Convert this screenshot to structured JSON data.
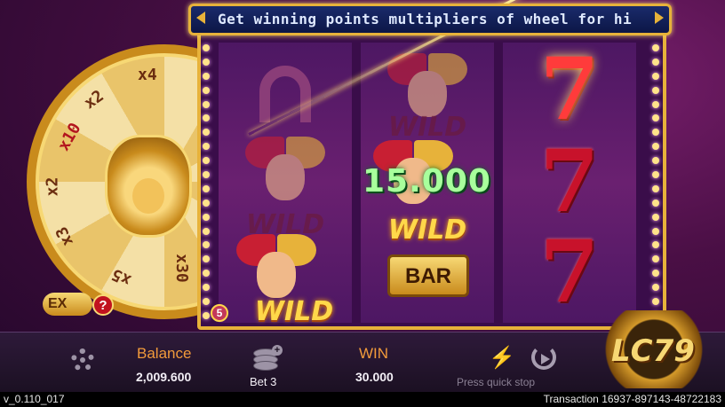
{
  "marquee": {
    "text": "Get winning points multipliers of wheel for hi"
  },
  "wheel": {
    "segments": [
      "x4",
      "x2",
      "x10",
      "x2",
      "x3",
      "x5",
      "x30"
    ],
    "ex_label": "EX",
    "help_label": "?"
  },
  "reels": {
    "reel1": {
      "symbols": [
        "horseshoe-icon",
        "jester-wild",
        "jester-wild"
      ]
    },
    "reel2": {
      "symbols": [
        "jester-wild",
        "jester-wild",
        "bar"
      ]
    },
    "reel3": {
      "symbols": [
        "seven",
        "seven",
        "seven"
      ]
    },
    "wild_label": "WILD",
    "bar_label": "BAR",
    "seven_label": "7",
    "multiplier_badge": "5"
  },
  "win_display": {
    "amount": "15.000"
  },
  "bottom_bar": {
    "balance_label": "Balance",
    "balance_value": "2,009.600",
    "bet_label": "Bet",
    "bet_value": "3",
    "win_label": "WIN",
    "win_value": "30.000",
    "quick_stop_hint": "Press quick stop"
  },
  "brand": {
    "logo_text": "LC79"
  },
  "status_bar": {
    "version": "v_0.110_017",
    "transaction": "Transaction 16937-897143-48722183"
  },
  "colors": {
    "accent_gold": "#e7b23a",
    "label_orange": "#f19a3b",
    "win_green": "#a8ff9c",
    "wild_yellow": "#ffd84a"
  }
}
